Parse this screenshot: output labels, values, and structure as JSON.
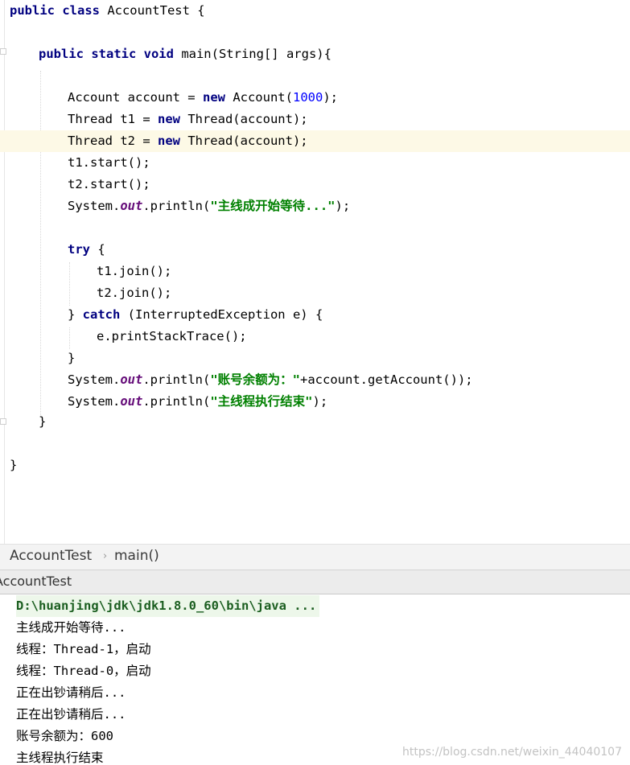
{
  "editor": {
    "lines": {
      "l1": {
        "a": "public class",
        "b": " AccountTest {"
      },
      "l2": {
        "a": "public static void",
        "b": " main(String[] args){"
      },
      "l3": {
        "a": "Account account = ",
        "b": "new",
        "c": " Account(",
        "d": "1000",
        "e": ");"
      },
      "l4": {
        "a": "Thread t1 = ",
        "b": "new",
        "c": " Thread(account);"
      },
      "l5": {
        "a": "Thread t2 = ",
        "b": "new",
        "c": " Thread(account);"
      },
      "l6": {
        "a": "t1.start();"
      },
      "l7": {
        "a": "t2.start();"
      },
      "l8": {
        "a": "System.",
        "b": "out",
        "c": ".println(",
        "d": "\"主线成开始等待...\"",
        "e": ");"
      },
      "l9": {
        "a": "try",
        "b": " {"
      },
      "l10": {
        "a": "t1.join();"
      },
      "l11": {
        "a": "t2.join();"
      },
      "l12": {
        "a": "} ",
        "b": "catch",
        "c": " (InterruptedException e) {"
      },
      "l13": {
        "a": "e.printStackTrace();"
      },
      "l14": {
        "a": "}"
      },
      "l15": {
        "a": "System.",
        "b": "out",
        "c": ".println(",
        "d": "\"账号余额为：\"",
        "e": "+account.getAccount());"
      },
      "l16": {
        "a": "System.",
        "b": "out",
        "c": ".println(",
        "d": "\"主线程执行结束\"",
        "e": ");"
      },
      "l17": {
        "a": "}"
      },
      "l18": {
        "a": "}"
      }
    }
  },
  "breadcrumb": {
    "class_name": "AccountTest",
    "method_name": "main()"
  },
  "run_panel": {
    "tab_label": "AccountTest",
    "command": "D:\\huanjing\\jdk\\jdk1.8.0_60\\bin\\java ...",
    "output": [
      "主线成开始等待...",
      "线程：Thread-1，启动",
      "线程：Thread-0，启动",
      "正在出钞请稍后...",
      "正在出钞请稍后...",
      "账号余额为：600",
      "主线程执行结束"
    ]
  },
  "watermark": "https://blog.csdn.net/weixin_44040107",
  "colors": {
    "keyword": "#000080",
    "string": "#008000",
    "number": "#0000ff",
    "field": "#660e7a",
    "caret_line": "#fdf9e6"
  }
}
